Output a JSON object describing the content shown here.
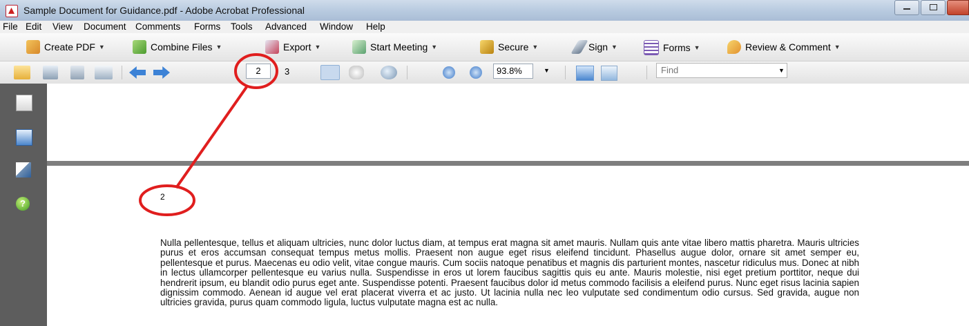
{
  "window": {
    "title": "Sample Document for Guidance.pdf - Adobe Acrobat Professional"
  },
  "menu": [
    "File",
    "Edit",
    "View",
    "Document",
    "Comments",
    "Forms",
    "Tools",
    "Advanced",
    "Window",
    "Help"
  ],
  "toolbar1": {
    "create_pdf": "Create PDF",
    "combine_files": "Combine Files",
    "export": "Export",
    "start_meeting": "Start Meeting",
    "secure": "Secure",
    "sign": "Sign",
    "forms": "Forms",
    "review_comment": "Review & Comment"
  },
  "toolbar2": {
    "current_page": "2",
    "page_total": "3",
    "zoom": "93.8%",
    "find_placeholder": "Find"
  },
  "document": {
    "page_number": "2",
    "body": "Nulla pellentesque, tellus et aliquam ultricies, nunc dolor luctus diam, at tempus erat magna sit amet mauris. Nullam quis ante vitae libero mattis pharetra. Mauris ultricies purus et eros accumsan consequat tempus metus mollis. Praesent non augue eget risus eleifend tincidunt. Phasellus augue dolor, ornare sit amet semper eu, pellentesque et purus. Maecenas eu odio velit, vitae congue mauris. Cum sociis natoque penatibus et magnis dis parturient montes, nascetur ridiculus mus. Donec at nibh in lectus ullamcorper pellentesque eu varius nulla. Suspendisse in eros ut lorem faucibus sagittis quis eu ante. Mauris molestie, nisi eget pretium porttitor, neque dui hendrerit ipsum, eu blandit odio purus eget ante. Suspendisse potenti. Praesent faucibus dolor id metus commodo facilisis a eleifend purus. Nunc eget risus lacinia sapien dignissim commodo. Aenean id augue vel erat placerat viverra et ac justo. Ut lacinia nulla nec leo vulputate sed condimentum odio cursus. Sed gravida, augue non ultricies gravida, purus quam commodo ligula, luctus vulputate magna est ac nulla."
  },
  "colors": {
    "annotation": "#e01e1e",
    "left_panel": "#5d5d5d",
    "page_divider": "#7e7e7e"
  }
}
